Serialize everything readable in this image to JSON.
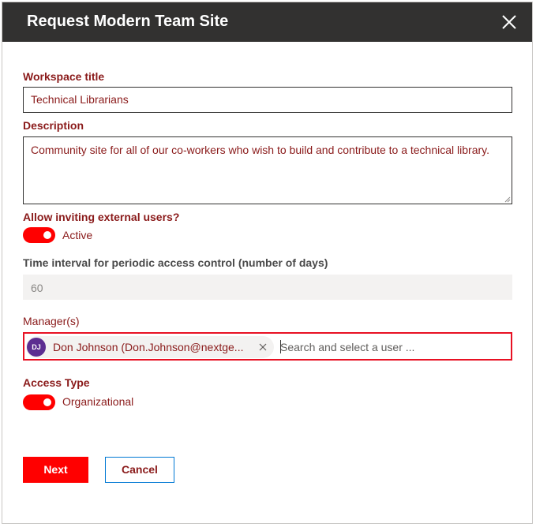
{
  "dialog": {
    "title": "Request Modern Team Site",
    "close_icon": "close-icon"
  },
  "form": {
    "workspace_title": {
      "label": "Workspace title",
      "value": "Technical Librarians"
    },
    "description": {
      "label": "Description",
      "value": "Community site for all of our co-workers who wish to build and contribute to a technical library."
    },
    "external_users": {
      "label": "Allow inviting external users?",
      "toggle_state": "Active",
      "on": true
    },
    "access_interval": {
      "label": "Time interval for periodic access control (number of days)",
      "value": "60"
    },
    "managers": {
      "label": "Manager(s)",
      "selected": [
        {
          "initials": "DJ",
          "display": "Don Johnson (Don.Johnson@nextge...",
          "avatar_color": "#5c2d91"
        }
      ],
      "placeholder": "Search and select a user ..."
    },
    "access_type": {
      "label": "Access Type",
      "toggle_state": "Organizational",
      "on": true
    }
  },
  "actions": {
    "next_label": "Next",
    "cancel_label": "Cancel"
  },
  "colors": {
    "header_bg": "#323130",
    "accent_red": "#ff0000",
    "label_text": "#8a1a1a",
    "error_border": "#e81123"
  }
}
